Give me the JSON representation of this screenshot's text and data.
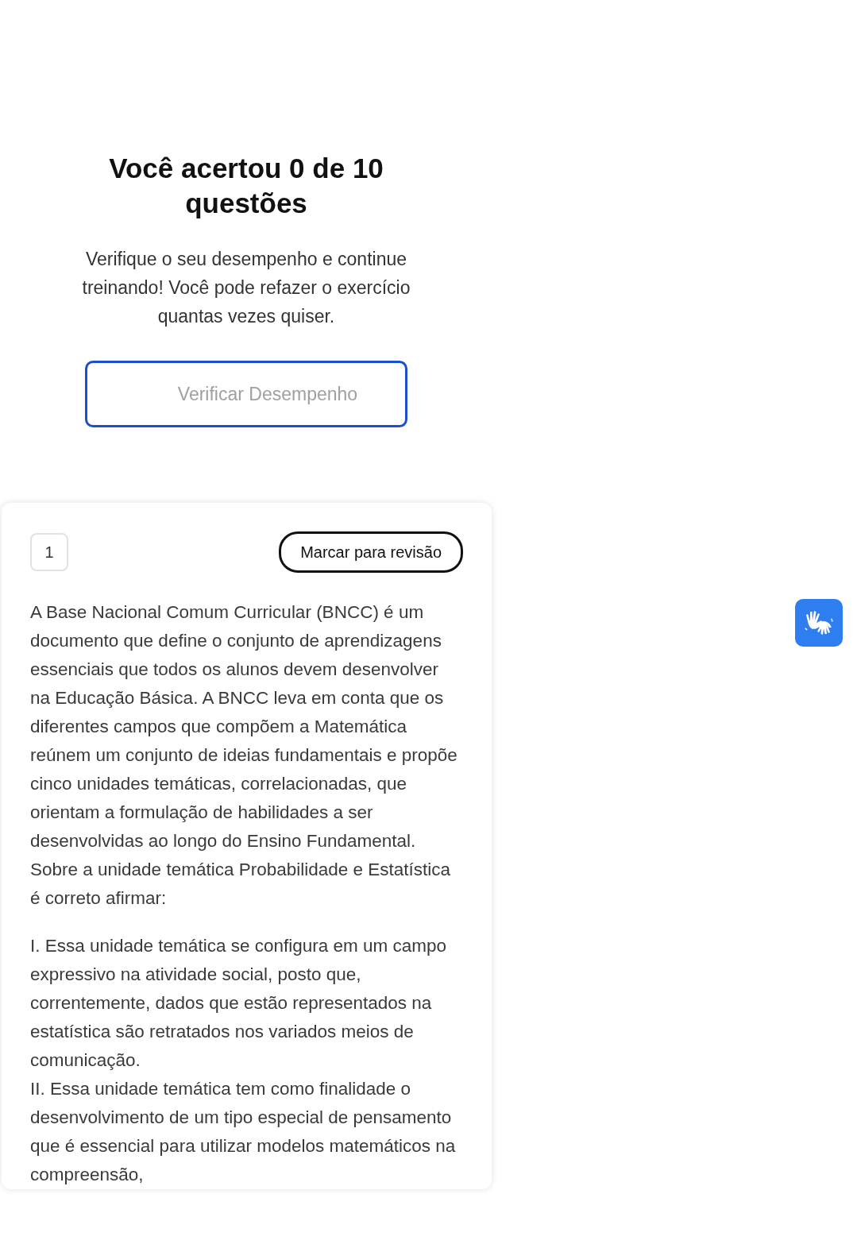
{
  "result": {
    "title": "Você acertou 0 de 10 questões",
    "description": "Verifique o seu desempenho e continue treinando! Você pode refazer o exercício quantas vezes quiser.",
    "button": {
      "label": "Verificar Desempenho",
      "disabled": true
    }
  },
  "question": {
    "number": "1",
    "review_button": "Marcar para revisão",
    "statement": "A Base Nacional Comum Curricular (BNCC) é um documento que define o conjunto de aprendizagens essenciais que todos os alunos devem desenvolver na Educação Básica. A BNCC leva em conta que os diferentes campos que compõem a Matemática reúnem um conjunto de ideias fundamentais e propõe cinco unidades temáticas, correlacionadas, que orientam a formulação de habilidades a ser desenvolvidas ao longo do Ensino Fundamental. Sobre a unidade temática Probabilidade e Estatística é correto afirmar:",
    "items": [
      "I. Essa unidade temática se configura em um campo expressivo na atividade social, posto que, correntemente, dados que estão representados na estatística são retratados nos variados meios de comunicação.",
      "II. Essa unidade temática tem como finalidade o desenvolvimento de um tipo especial de pensamento que é essencial para utilizar modelos matemáticos na compreensão,"
    ]
  }
}
